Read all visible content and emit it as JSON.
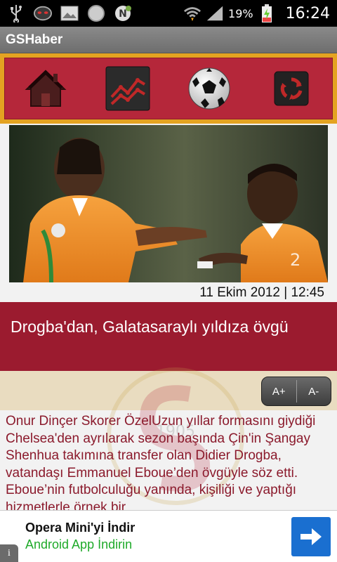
{
  "status_bar": {
    "icons": [
      "usb-icon",
      "mask-app-icon",
      "gallery-icon",
      "circle-icon",
      "n-notification-icon",
      "wifi-icon",
      "signal-icon",
      "battery-charging-icon"
    ],
    "battery_text": "19%",
    "time": "16:24"
  },
  "app": {
    "title": "GSHaber"
  },
  "nav": {
    "items": [
      {
        "icon": "home-icon"
      },
      {
        "icon": "trend-chart-icon"
      },
      {
        "icon": "soccer-ball-icon"
      },
      {
        "icon": "refresh-icon"
      }
    ]
  },
  "article": {
    "date": "11 Ekim 2012 | 12:45",
    "headline": "Drogba'dan, Galatasaraylı yıldıza övgü",
    "font_increase_label": "A+",
    "font_decrease_label": "A-",
    "watermark_text": "1905",
    "body": "Onur Dinçer  Skorer ÖzelUzun yıllar formasını giydiği Chelsea'den ayrılarak sezon başında Çin'in Şangay Shenhua takımına transfer olan Didier Drogba, vatandaşı Emmanuel Eboue’den övgüyle söz etti. Eboue’nin futbolculuğu yanında, kişiliği ve yaptığı hizmetlerle örnek bir"
  },
  "ad": {
    "title": "Opera Mini'yi İndir",
    "subtitle": "Android App İndirin",
    "info_label": "i"
  },
  "colors": {
    "nav_frame": "#e4a321",
    "nav_bg": "#b5273a",
    "headline_bg": "#9b1b2f",
    "body_text": "#8b1a2c",
    "ad_subtitle": "#1faa2a",
    "ad_button": "#1a6fd0"
  }
}
